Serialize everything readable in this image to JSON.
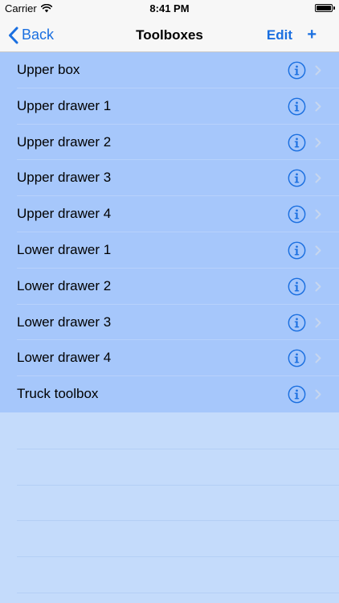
{
  "status_bar": {
    "carrier": "Carrier",
    "time": "8:41 PM"
  },
  "nav_bar": {
    "back_label": "Back",
    "title": "Toolboxes",
    "edit_label": "Edit",
    "add_label": "+"
  },
  "toolboxes": [
    {
      "label": "Upper box"
    },
    {
      "label": "Upper drawer 1"
    },
    {
      "label": "Upper drawer 2"
    },
    {
      "label": "Upper drawer 3"
    },
    {
      "label": "Upper drawer 4"
    },
    {
      "label": "Lower drawer 1"
    },
    {
      "label": "Lower drawer 2"
    },
    {
      "label": "Lower drawer 3"
    },
    {
      "label": "Lower drawer 4"
    },
    {
      "label": "Truck toolbox"
    }
  ],
  "icons": {
    "info": "info-icon",
    "chevron": "chevron-right-icon",
    "back": "chevron-left-icon",
    "wifi": "wifi-icon",
    "battery": "battery-icon"
  },
  "colors": {
    "accent": "#1a6fe0",
    "row_background": "#a6c7fb",
    "empty_background": "#c4dbfb",
    "bar_background": "#f7f7f7"
  }
}
